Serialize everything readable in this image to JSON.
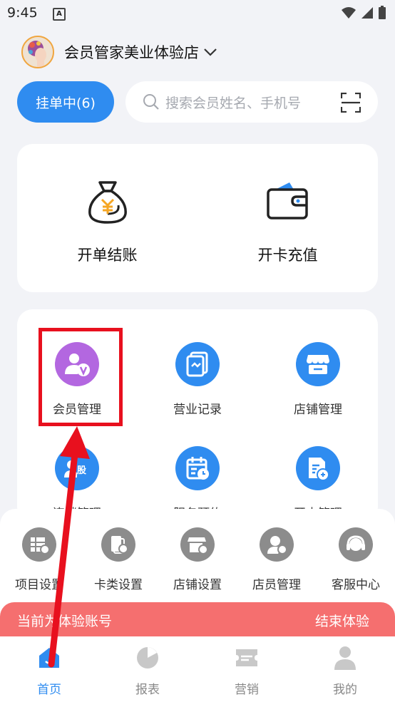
{
  "status_bar": {
    "time": "9:45",
    "notification_letter": "A"
  },
  "store": {
    "name": "会员管家美业体验店"
  },
  "hang_order": {
    "label": "挂单中(6)"
  },
  "search": {
    "placeholder": "搜索会员姓名、手机号"
  },
  "quick_actions": [
    {
      "label": "开单结账",
      "icon": "money-bag-icon"
    },
    {
      "label": "开卡充值",
      "icon": "wallet-icon"
    }
  ],
  "modules": [
    {
      "label": "会员管理",
      "icon": "member-v-icon",
      "color": "#b367e0"
    },
    {
      "label": "营业记录",
      "icon": "record-icon",
      "color": "#2f8cf0"
    },
    {
      "label": "店铺管理",
      "icon": "shop-icon",
      "color": "#2f8cf0"
    },
    {
      "label": "连锁管理",
      "visible_text": "连锁管理",
      "icon": "chain-icon",
      "color": "#2f8cf0"
    },
    {
      "label": "服务预约",
      "icon": "calendar-icon",
      "color": "#2f8cf0"
    },
    {
      "label": "开支管理",
      "icon": "expense-icon",
      "color": "#2f8cf0"
    }
  ],
  "tools": [
    {
      "label": "项目设置",
      "icon": "project-settings-icon"
    },
    {
      "label": "卡类设置",
      "icon": "card-settings-icon"
    },
    {
      "label": "店铺设置",
      "icon": "shop-settings-icon"
    },
    {
      "label": "店员管理",
      "icon": "staff-icon"
    },
    {
      "label": "客服中心",
      "icon": "headset-icon"
    }
  ],
  "trial_bar": {
    "text": "当前为体验账号",
    "end_label": "结束体验"
  },
  "tabs": [
    {
      "label": "首页",
      "icon": "home-icon",
      "active": true
    },
    {
      "label": "报表",
      "icon": "pie-chart-icon",
      "active": false
    },
    {
      "label": "营销",
      "icon": "ticket-icon",
      "active": false
    },
    {
      "label": "我的",
      "icon": "user-icon",
      "active": false
    }
  ],
  "colors": {
    "accent": "#2f8cf0",
    "member": "#b367e0",
    "trial": "#f56f6f",
    "highlight": "#e8101e"
  }
}
